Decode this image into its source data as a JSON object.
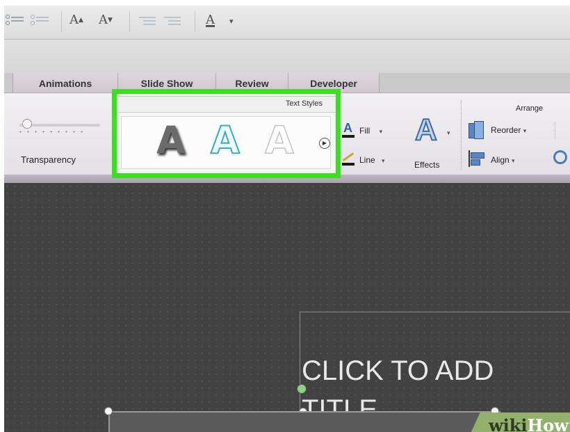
{
  "toolbar": {
    "font_size_up": "A",
    "font_size_down": "A",
    "font_color": "A",
    "dropdown_caret": "▾"
  },
  "tabs": [
    "Animations",
    "Slide Show",
    "Review",
    "Developer"
  ],
  "ribbon": {
    "transparency_label": "Transparency",
    "text_styles": {
      "heading": "Text Styles",
      "samples": [
        "A",
        "A",
        "A"
      ],
      "more_arrow": "▶"
    },
    "fill_label": "Fill",
    "line_label": "Line",
    "effects_label": "Effects",
    "effects_glyph": "A",
    "arrange": {
      "heading": "Arrange",
      "reorder_label": "Reorder",
      "align_label": "Align"
    }
  },
  "slide": {
    "title_placeholder": "CLICK TO ADD TITLE"
  },
  "watermark": {
    "wiki": "wiki",
    "how": "How"
  },
  "colors": {
    "highlight": "#39e01d",
    "slide_background": "#424242",
    "watermark_bg": "#93b16c"
  }
}
